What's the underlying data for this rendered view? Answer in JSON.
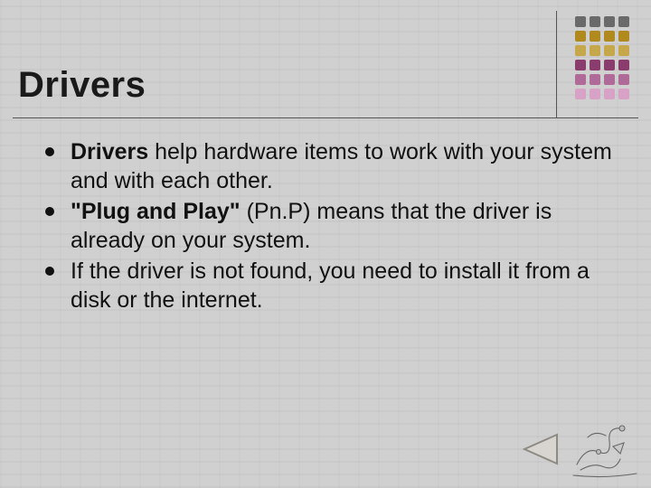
{
  "title": "Drivers",
  "bullets": [
    {
      "bold": "Drivers",
      "rest": " help hardware items to work with your system and with each other."
    },
    {
      "bold": "\"Plug and Play\"",
      "rest": " (Pn.P) means that the driver is already on your system."
    },
    {
      "bold": "",
      "rest": "If the driver is not found, you need to install it from a disk or the internet."
    }
  ],
  "decor": {
    "dot_colors": [
      "#6a6a6a",
      "#6a6a6a",
      "#6a6a6a",
      "#6a6a6a",
      "#b0891f",
      "#b0891f",
      "#b0891f",
      "#b0891f",
      "#c6a84a",
      "#c6a84a",
      "#c6a84a",
      "#c6a84a",
      "#8a3d6d",
      "#8a3d6d",
      "#8a3d6d",
      "#8a3d6d",
      "#b06a97",
      "#b06a97",
      "#b06a97",
      "#b06a97",
      "#d7a2c6",
      "#d7a2c6",
      "#d7a2c6",
      "#d7a2c6"
    ]
  },
  "nav": {
    "back_label": "Back"
  }
}
